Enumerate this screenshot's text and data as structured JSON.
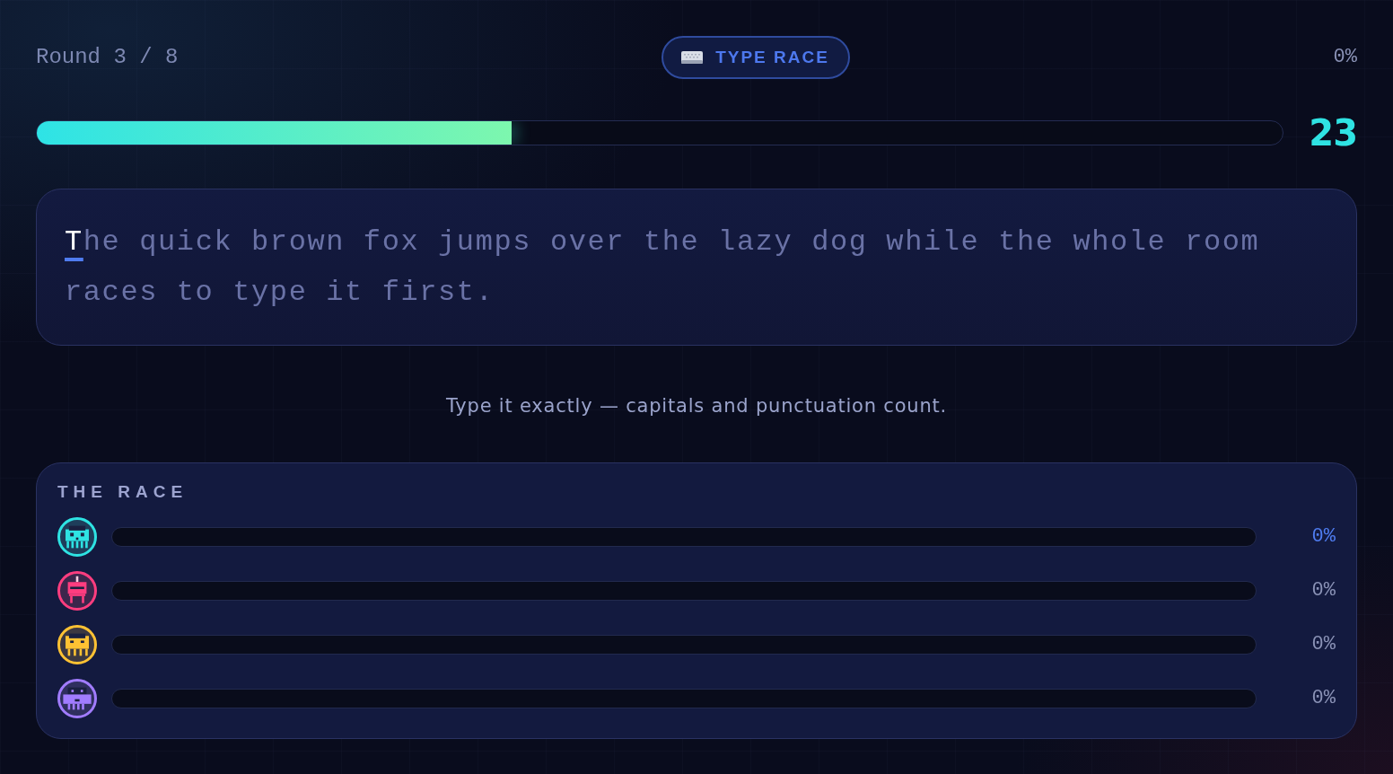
{
  "header": {
    "round": "Round 3 / 8",
    "badge": {
      "label": "TYPE RACE"
    },
    "progress_reading": "0%"
  },
  "timer": {
    "level": 0.381,
    "seconds": "23"
  },
  "prompt": {
    "current": "T",
    "remaining": "he quick brown fox jumps over the lazy dog while the whole room races to type it first."
  },
  "hint": "Type it exactly — capitals and punctuation count.",
  "race": {
    "title": "THE RACE",
    "racers": [
      {
        "kind": "invader",
        "color": "#2ee3e3",
        "is_you": true,
        "reading": "0%"
      },
      {
        "kind": "robot",
        "color": "#ff3d7f",
        "is_you": false,
        "reading": "0%"
      },
      {
        "kind": "cat",
        "color": "#ffc233",
        "is_you": false,
        "reading": "0%"
      },
      {
        "kind": "crab",
        "color": "#a17cff",
        "is_you": false,
        "reading": "0%"
      }
    ]
  }
}
